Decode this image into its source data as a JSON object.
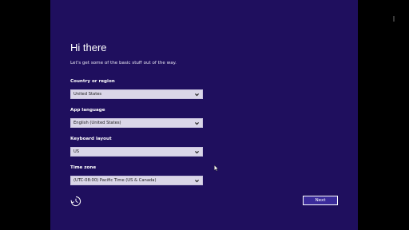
{
  "page": {
    "title": "Hi there",
    "subtitle": "Let's get some of the basic stuff out of the way."
  },
  "fields": {
    "country": {
      "label": "Country or region",
      "value": "United States"
    },
    "language": {
      "label": "App language",
      "value": "English (United States)"
    },
    "keyboard": {
      "label": "Keyboard layout",
      "value": "US"
    },
    "timezone": {
      "label": "Time zone",
      "value": "(UTC-08:00) Pacific Time (US & Canada)"
    }
  },
  "actions": {
    "next_label": "Next",
    "back_icon": "ease-of-access-icon"
  },
  "colors": {
    "background": "#1f0f5e",
    "select_bg": "#dad6e8",
    "next_bg": "#3a2a9a"
  }
}
